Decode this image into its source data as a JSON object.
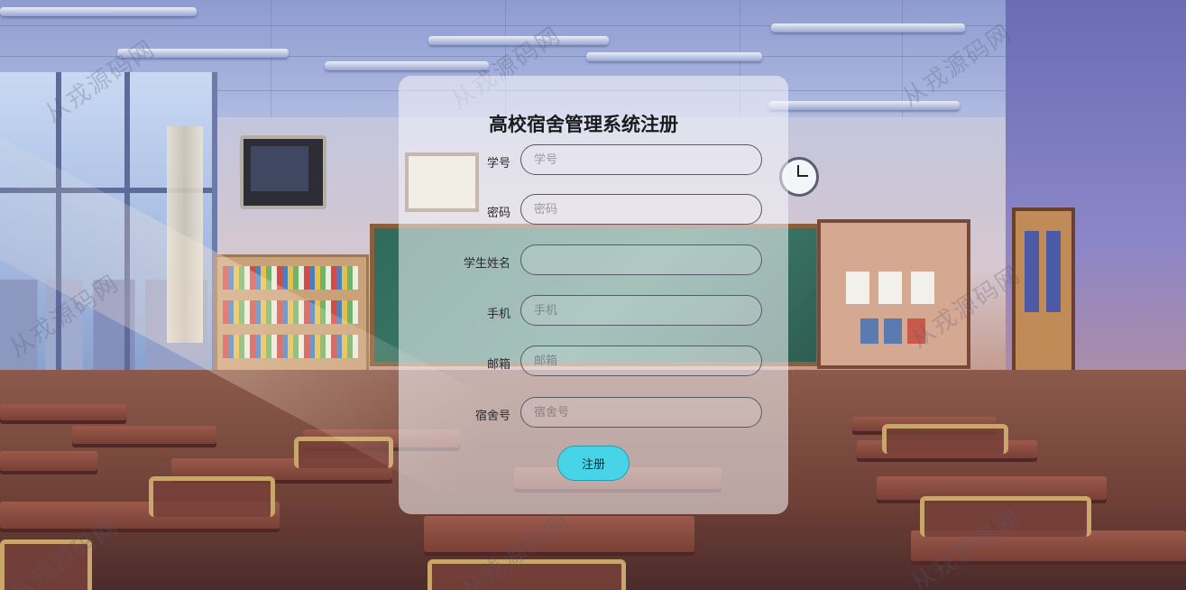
{
  "form": {
    "title": "高校宿舍管理系统注册",
    "fields": [
      {
        "label": "学号",
        "placeholder": "学号",
        "value": ""
      },
      {
        "label": "密码",
        "placeholder": "密码",
        "value": ""
      },
      {
        "label": "学生姓名",
        "placeholder": "",
        "value": ""
      },
      {
        "label": "手机",
        "placeholder": "手机",
        "value": ""
      },
      {
        "label": "邮箱",
        "placeholder": "邮箱",
        "value": ""
      },
      {
        "label": "宿舍号",
        "placeholder": "宿舍号",
        "value": ""
      }
    ],
    "submit_label": "注册"
  },
  "watermark": "从戎源码网",
  "colors": {
    "submit_button": "#48d4e8",
    "panel": "rgba(248,248,252,0.55)"
  }
}
